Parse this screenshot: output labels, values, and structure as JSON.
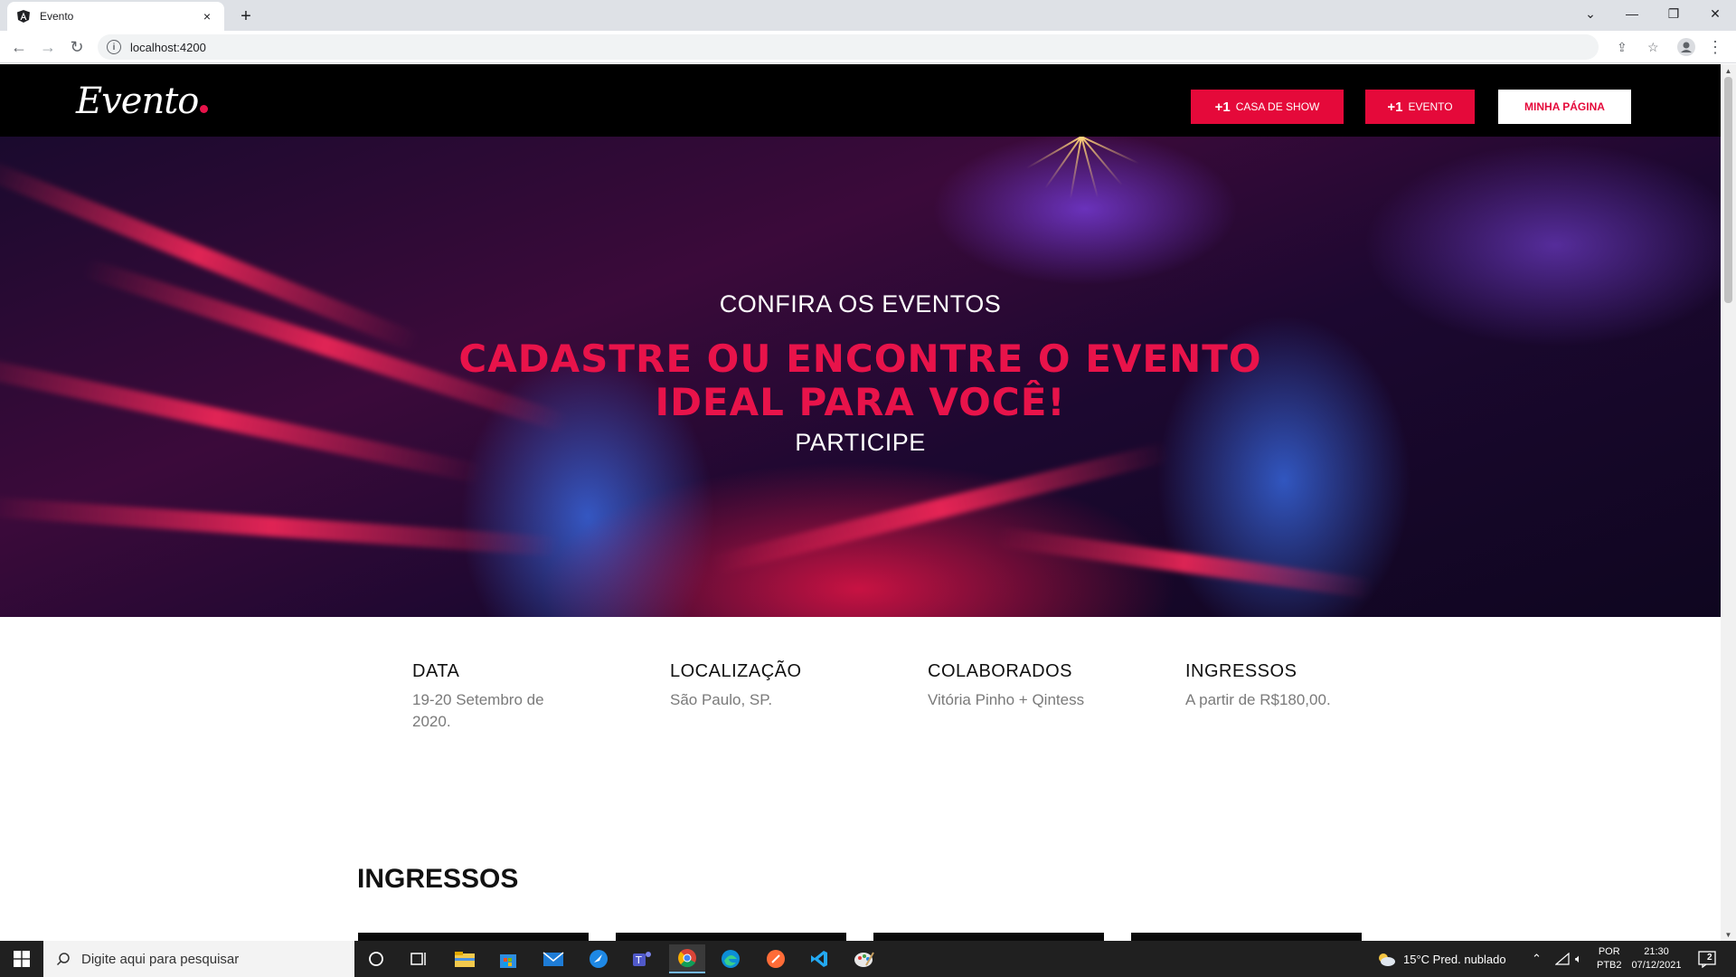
{
  "browser": {
    "tab_title": "Evento",
    "tab_close": "×",
    "new_tab": "+",
    "url": "localhost:4200"
  },
  "header": {
    "logo": "Evento",
    "btn_casa_plus": "+1",
    "btn_casa_label": "CASA DE SHOW",
    "btn_evento_plus": "+1",
    "btn_evento_label": "EVENTO",
    "btn_minha_pagina": "MINHA PÁGINA"
  },
  "hero": {
    "subtitle": "CONFIRA OS EVENTOS",
    "title_line1": "CADASTRE OU ENCONTRE O EVENTO",
    "title_line2": "IDEAL PARA VOCÊ!",
    "footer": "PARTICIPE"
  },
  "info": [
    {
      "heading": "DATA",
      "value": "19-20 Setembro de 2020."
    },
    {
      "heading": "LOCALIZAÇÃO",
      "value": "São Paulo, SP."
    },
    {
      "heading": "COLABORADOS",
      "value": "Vitória Pinho + Qintess"
    },
    {
      "heading": "INGRESSOS",
      "value": "A partir de R$180,00."
    }
  ],
  "ingressos_section": {
    "title": "INGRESSOS"
  },
  "taskbar": {
    "search_placeholder": "Digite aqui para pesquisar",
    "weather": "15°C  Pred. nublado",
    "lang_line1": "POR",
    "lang_line2": "PTB2",
    "time": "21:30",
    "date": "07/12/2021",
    "notif_count": "2"
  }
}
